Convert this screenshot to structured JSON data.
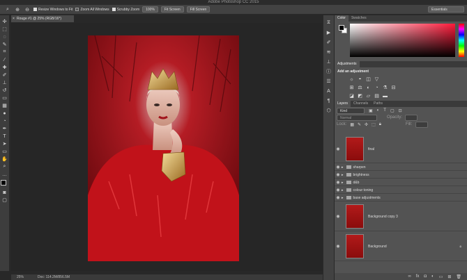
{
  "app": {
    "title": "Adobe Photoshop CC 2015"
  },
  "options": {
    "resize": "Resize Windows to Fit",
    "zoom_all": "Zoom All Windows",
    "scrubby": "Scrubby Zoom",
    "pct": "100%",
    "fit": "Fit Screen",
    "fill": "Fill Screen",
    "workspace": "Essentials"
  },
  "document": {
    "tab": "Rouge #1 @ 25% (RGB/16*)",
    "zoom": "25%",
    "doc_size": "Doc: 114.2M/856.5M"
  },
  "color_panel": {
    "tabs": [
      "Color",
      "Swatches"
    ]
  },
  "adjustments": {
    "tab": "Adjustments",
    "heading": "Add an adjustment",
    "row1": [
      "☼",
      "◓",
      "◫",
      "▽"
    ],
    "row2": [
      "⊞",
      "⚖",
      "◐",
      "◔",
      "⚗",
      "⊟"
    ],
    "row3": [
      "◪",
      "◩",
      "▱",
      "▤",
      "▬"
    ]
  },
  "layers_panel": {
    "tabs": [
      "Layers",
      "Channels",
      "Paths"
    ],
    "filter": "Kind",
    "blend": "Normal",
    "opacity_label": "Opacity:",
    "fill_label": "Fill:",
    "lock_label": "Lock:",
    "layers": [
      {
        "name": "final",
        "type": "pixel"
      },
      {
        "name": "sharpen",
        "type": "group"
      },
      {
        "name": "brightness",
        "type": "group"
      },
      {
        "name": "d&b",
        "type": "group"
      },
      {
        "name": "colour toning",
        "type": "group"
      },
      {
        "name": "base adjustments",
        "type": "group"
      },
      {
        "name": "Background copy 3",
        "type": "pixel"
      },
      {
        "name": "Background",
        "type": "pixel",
        "locked": true
      }
    ]
  },
  "colors": {
    "accent": "#c01414",
    "panel": "#535353",
    "canvas": "#262626"
  }
}
